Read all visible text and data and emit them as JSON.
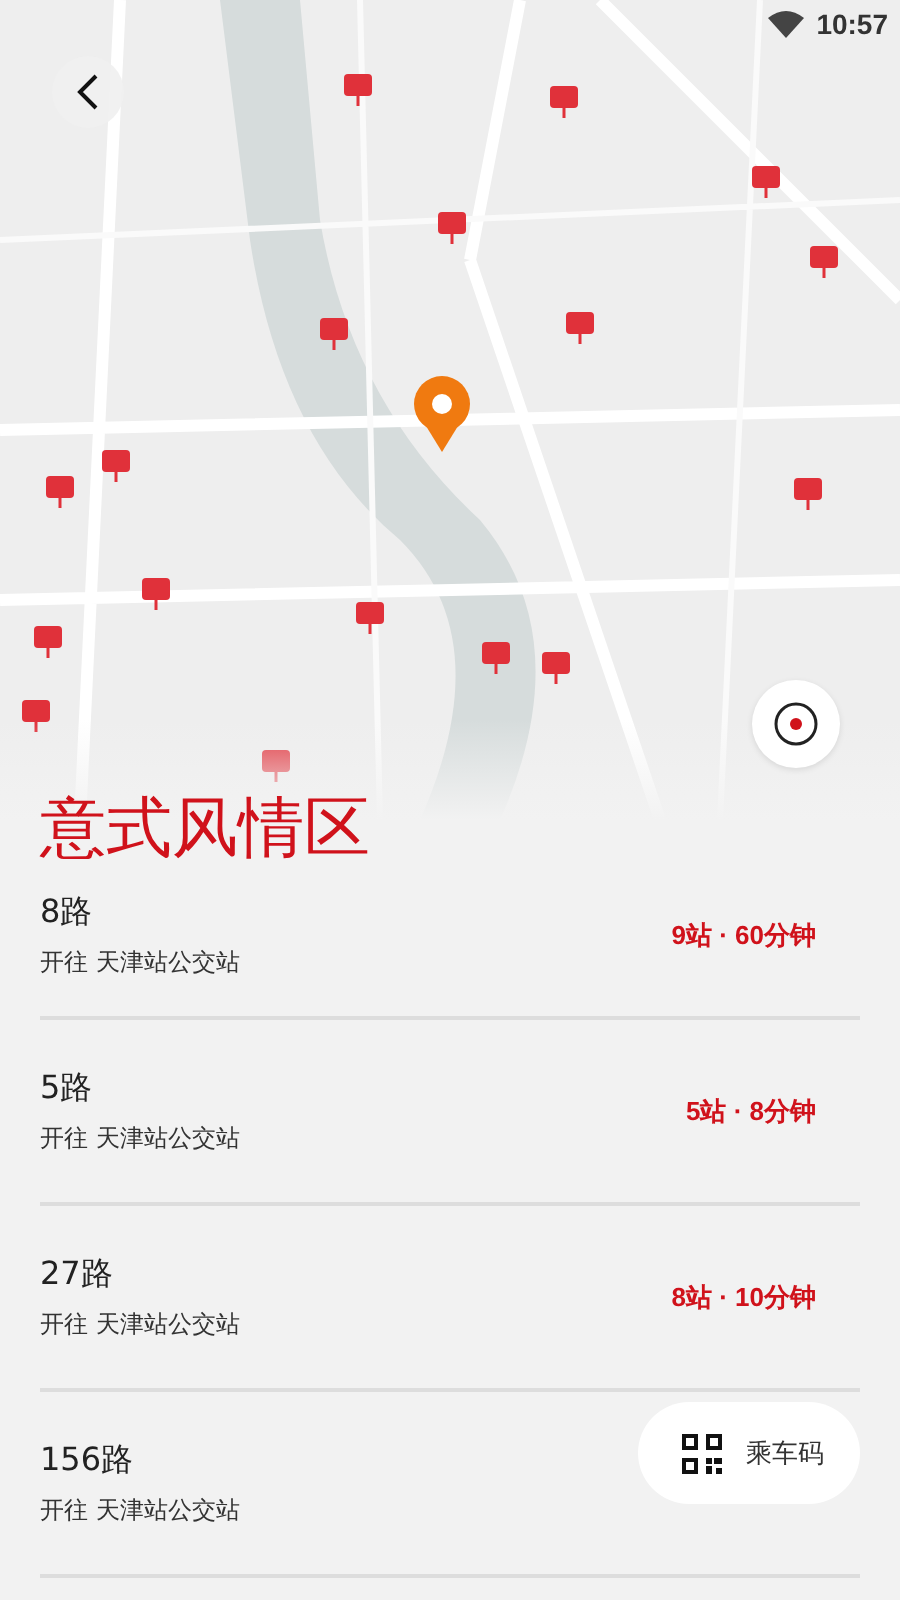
{
  "status_bar": {
    "time": "10:57"
  },
  "stop_name": "意式风情区",
  "routes": [
    {
      "name": "8路",
      "direction": "开往 天津站公交站",
      "eta": "9站 · 60分钟"
    },
    {
      "name": "5路",
      "direction": "开往 天津站公交站",
      "eta": "5站 · 8分钟"
    },
    {
      "name": "27路",
      "direction": "开往 天津站公交站",
      "eta": "8站 · 10分钟"
    },
    {
      "name": "156路",
      "direction": "开往 天津站公交站"
    }
  ],
  "ride_code_button": {
    "label": "乘车码"
  }
}
